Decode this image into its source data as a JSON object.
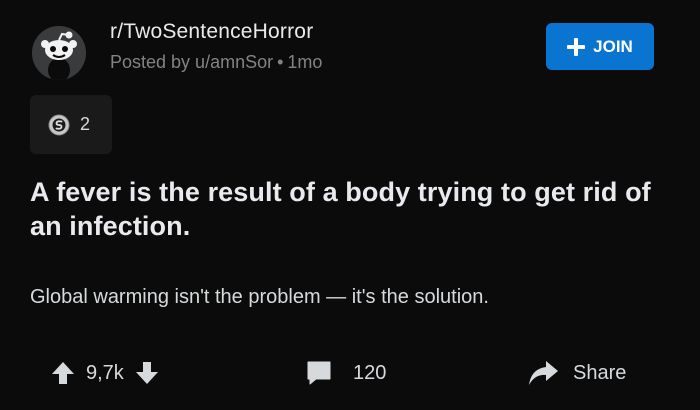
{
  "post": {
    "subreddit": "r/TwoSentenceHorror",
    "meta": {
      "posted_by": "Posted by u/amnSor",
      "separator": "•",
      "age": "1mo"
    },
    "join_label": "JOIN",
    "award": {
      "icon": "silver-award-icon",
      "count": "2"
    },
    "title": "A fever is the result of a body trying to get rid of an infection.",
    "body": "Global warming isn't the problem — it's the solution.",
    "actions": {
      "upvote_icon": "upvote-arrow-icon",
      "vote_count": "9,7k",
      "downvote_icon": "downvote-arrow-icon",
      "comment_icon": "comment-bubble-icon",
      "comment_count": "120",
      "share_icon": "share-arrow-icon",
      "share_label": "Share"
    }
  },
  "colors": {
    "background": "#0b0b0c",
    "text": "#d7dadc",
    "muted": "#818384",
    "accent": "#0a74d1",
    "award_bg": "#1a1a1b"
  }
}
